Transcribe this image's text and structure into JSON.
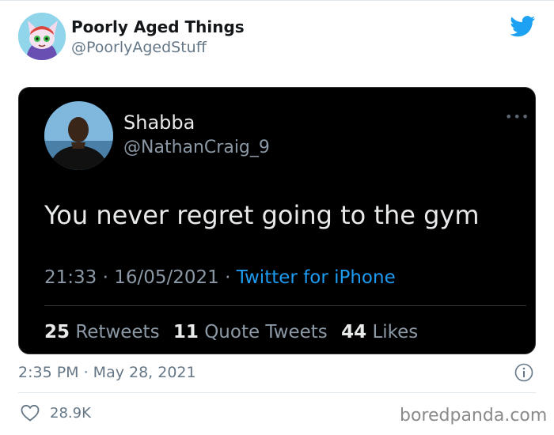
{
  "header": {
    "display_name": "Poorly Aged Things",
    "handle": "@PoorlyAgedStuff",
    "logo_icon": "twitter-bird-icon",
    "accent_color": "#1da1f2"
  },
  "embedded_tweet": {
    "name": "Shabba",
    "handle": "@NathanCraig_9",
    "text": "You never regret going to the gym",
    "time": "21:33",
    "separator": "·",
    "date": "16/05/2021",
    "source": "Twitter for iPhone",
    "source_color": "#1d9bf0",
    "more_icon": "more-dots-icon",
    "stats": {
      "retweets_count": "25",
      "retweets_label": "Retweets",
      "quotes_count": "11",
      "quotes_label": "Quote Tweets",
      "likes_count": "44",
      "likes_label": "Likes"
    }
  },
  "footer": {
    "timestamp": "2:35 PM · May 28, 2021",
    "info_icon": "info-icon",
    "like_icon": "heart-icon",
    "like_count": "28.9K",
    "watermark": "boredpanda.com"
  }
}
